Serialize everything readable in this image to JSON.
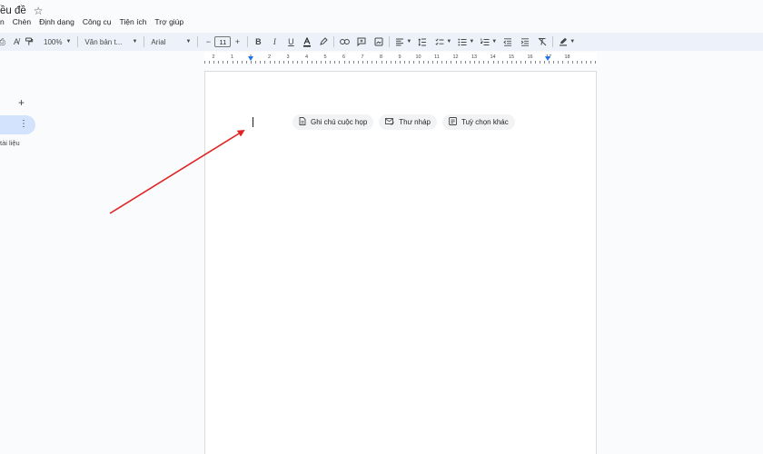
{
  "window": {
    "title": "ều đề",
    "star_icon": "star-icon"
  },
  "menu": {
    "items": [
      "n",
      "Chèn",
      "Định dạng",
      "Công cụ",
      "Tiện ích",
      "Trợ giúp"
    ]
  },
  "toolbar": {
    "zoom": "100%",
    "style": "Văn bản t...",
    "font": "Arial",
    "font_size": "11",
    "minus": "−",
    "plus": "+"
  },
  "ruler": {
    "labels": [
      "2",
      "1",
      "1",
      "2",
      "3",
      "4",
      "5",
      "6",
      "7",
      "8",
      "9",
      "10",
      "11",
      "12",
      "13",
      "14",
      "15",
      "16",
      "17",
      "18"
    ]
  },
  "sidebar": {
    "add_symbol": "+",
    "more_symbol": "⋮",
    "label": "tài liệu"
  },
  "document": {
    "chips": [
      {
        "label": "Ghi chú cuộc họp",
        "icon": "document-icon"
      },
      {
        "label": "Thư nháp",
        "icon": "email-draft-icon"
      },
      {
        "label": "Tuỳ chọn khác",
        "icon": "template-icon"
      }
    ]
  },
  "annotation": {
    "color": "#e02424"
  }
}
